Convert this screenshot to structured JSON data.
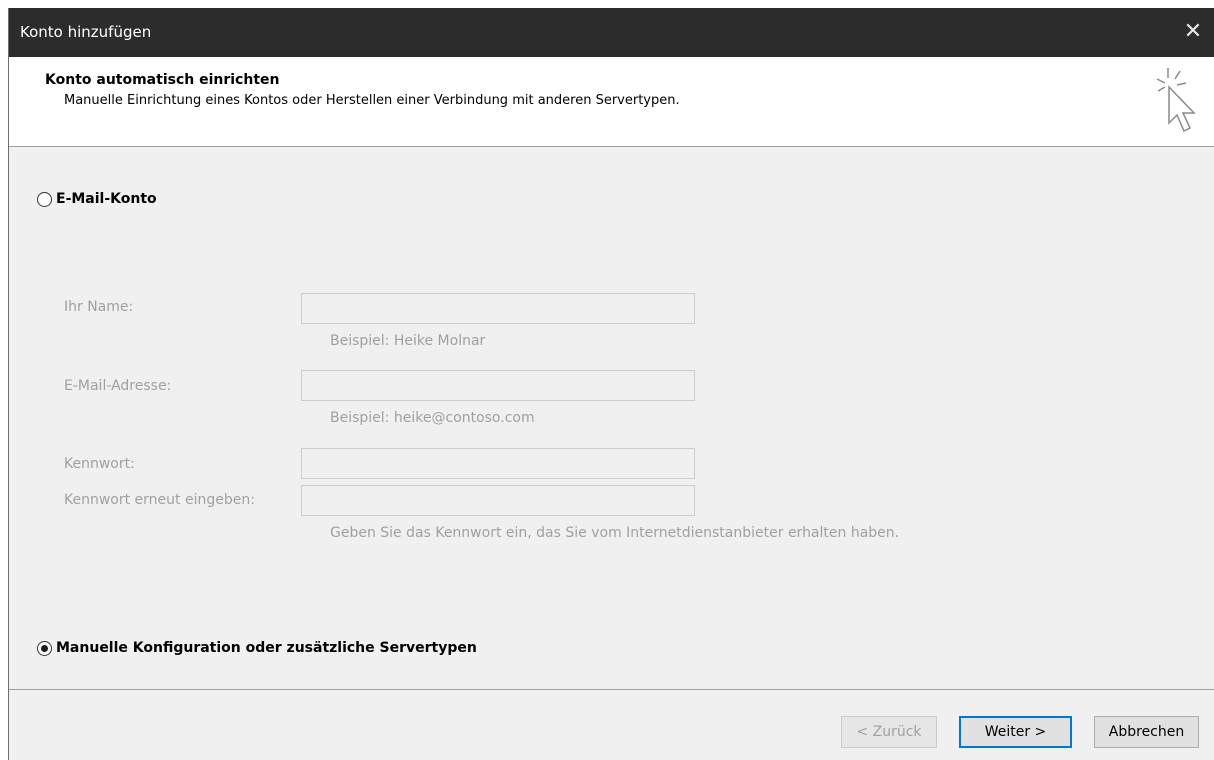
{
  "window": {
    "title": "Konto hinzufügen",
    "close_glyph": "✕"
  },
  "header": {
    "title": "Konto automatisch einrichten",
    "subtitle": "Manuelle Einrichtung eines Kontos oder Herstellen einer Verbindung mit anderen Servertypen.",
    "icon": "wizard-cursor-icon"
  },
  "options": {
    "email_account": {
      "label": "E-Mail-Konto",
      "selected": false
    },
    "manual_config": {
      "label": "Manuelle Konfiguration oder zusätzliche Servertypen",
      "selected": true
    }
  },
  "form": {
    "name": {
      "label": "Ihr Name:",
      "value": "",
      "hint": "Beispiel: Heike Molnar"
    },
    "email": {
      "label": "E-Mail-Adresse:",
      "value": "",
      "hint": "Beispiel: heike@contoso.com"
    },
    "password": {
      "label": "Kennwort:",
      "value": ""
    },
    "password_repeat": {
      "label": "Kennwort erneut eingeben:",
      "value": "",
      "hint": "Geben Sie das Kennwort ein, das Sie vom Internetdienstanbieter erhalten haben."
    }
  },
  "buttons": {
    "back": "< Zurück",
    "next": "Weiter >",
    "cancel": "Abbrechen"
  },
  "colors": {
    "titlebar": "#2c2c2c",
    "dialog_bg": "#f0f0f0",
    "focus_accent": "#0078d7",
    "disabled_text": "#a0a0a0"
  }
}
